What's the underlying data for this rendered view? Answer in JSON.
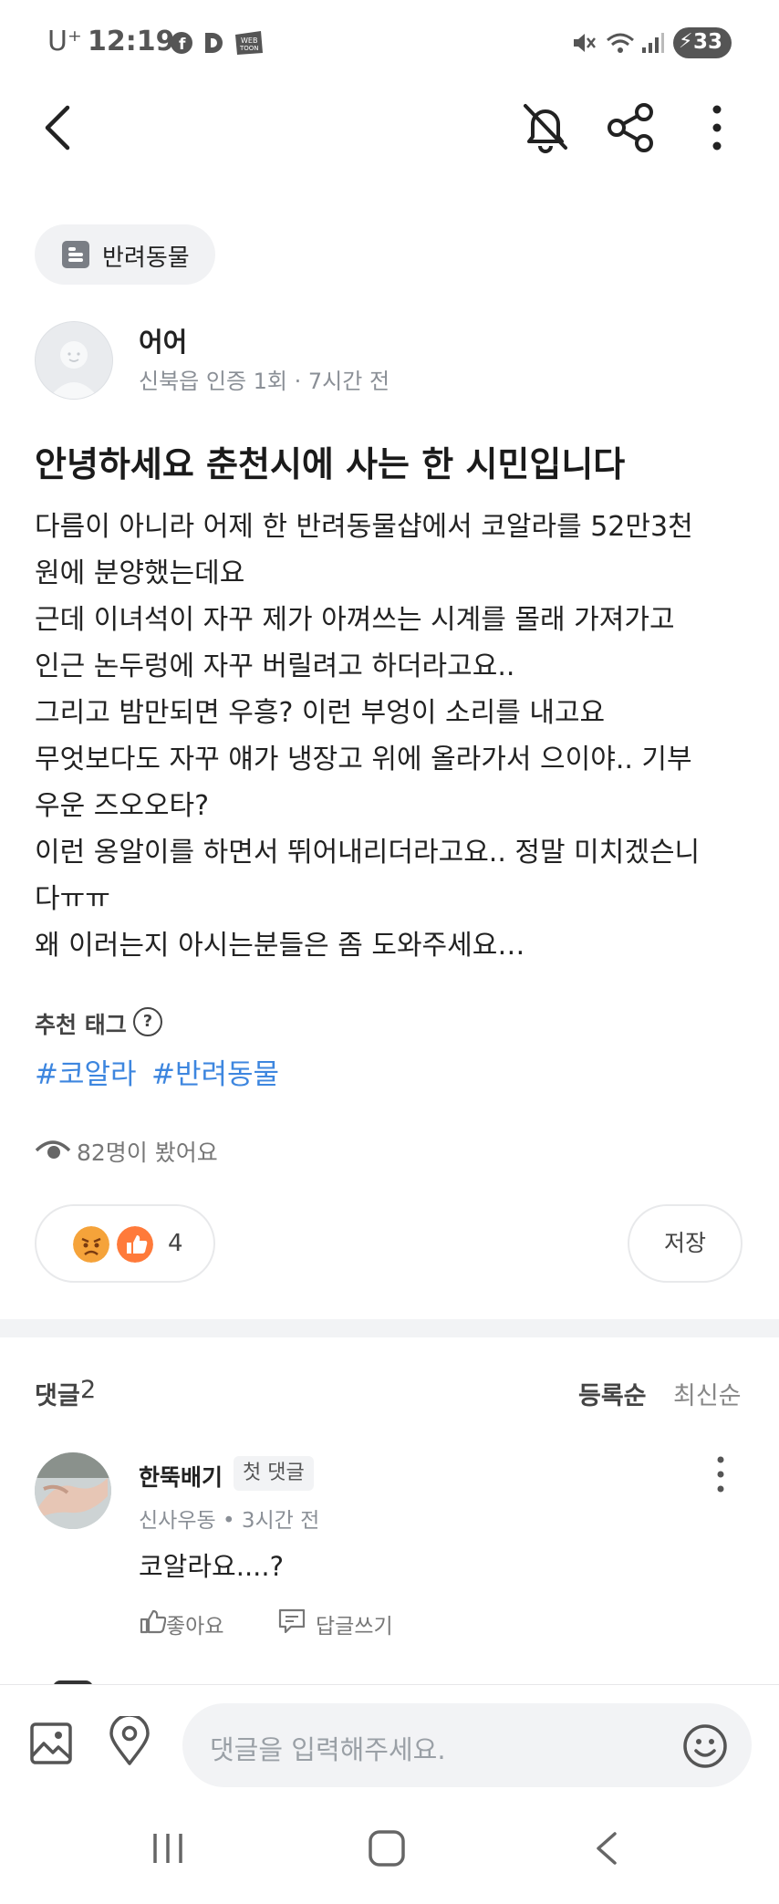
{
  "status_bar": {
    "carrier": "U⁺",
    "time": "12:19",
    "app_icons": [
      "facebook-icon",
      "d-icon",
      "webtoon-icon"
    ],
    "system_icons": [
      "mute-icon",
      "wifi-icon",
      "signal-icon"
    ],
    "battery": "33"
  },
  "header": {
    "back_icon": "back-arrow-icon",
    "actions": [
      "notification-off-icon",
      "share-icon",
      "more-vert-icon"
    ]
  },
  "post": {
    "category": "반려동물",
    "author": {
      "name": "어어",
      "meta": "신북읍 인증 1회 · 7시간 전"
    },
    "title": "안녕하세요 춘천시에 사는 한 시민입니다",
    "body_lines": [
      "다름이 아니라 어제 한 반려동물샵에서 코알라를 52만3천",
      "원에 분양했는데요",
      "근데 이녀석이 자꾸 제가 아껴쓰는 시계를 몰래 가져가고",
      "인근 논두렁에 자꾸 버릴려고 하더라고요..",
      "그리고 밤만되면 우흥? 이런 부엉이 소리를 내고요",
      "무엇보다도 자꾸 얘가 냉장고 위에 올라가서 으이야.. 기부",
      "우운 즈오오타?",
      "이런 옹알이를 하면서 뛰어내리더라고요.. 정말 미치겠슨니",
      "다ㅠㅠ",
      "왜 이러는지 아시는분들은 좀 도와주세요…"
    ],
    "tags_label": "추천 태그",
    "tags": [
      "#코알라",
      "#반려동물"
    ],
    "views": "82명이 봤어요",
    "reaction_count": "4",
    "save_label": "저장"
  },
  "comments": {
    "label": "댓글",
    "count": "2",
    "sort_options": [
      "등록순",
      "최신순"
    ],
    "active_sort": "등록순",
    "items": [
      {
        "author": "한뚝배기",
        "badge": "첫 댓글",
        "meta": "신사우동 • 3시간 전",
        "text": "코알라요....?",
        "like_label": "좋아요",
        "reply_label": "답글쓰기"
      }
    ]
  },
  "composer": {
    "placeholder": "댓글을 입력해주세요."
  },
  "colors": {
    "tag": "#3d86df",
    "angry": "#f5a33a",
    "like": "#ff7a3a"
  }
}
